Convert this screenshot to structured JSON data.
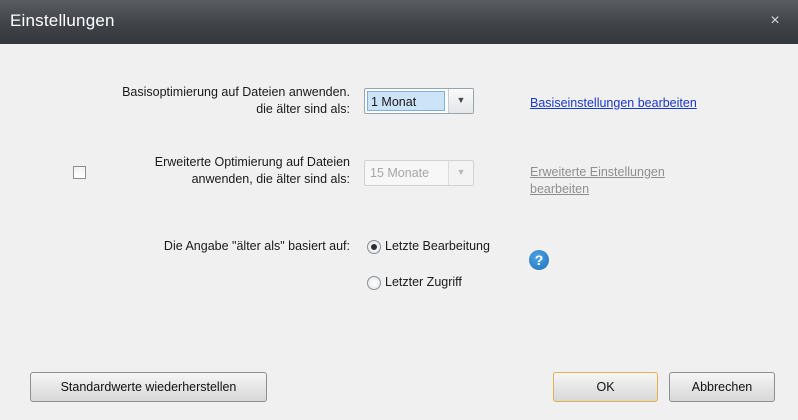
{
  "window": {
    "title": "Einstellungen",
    "close_glyph": "×"
  },
  "basic": {
    "label": "Basisoptimierung auf Dateien anwenden. die älter sind als:",
    "dropdown_value": "1 Monat",
    "link": "Basiseinstellungen bearbeiten"
  },
  "advanced": {
    "checked": false,
    "label": "Erweiterte Optimierung auf Dateien anwenden, die älter sind als:",
    "dropdown_value": "15 Monate",
    "link": "Erweiterte Einstellungen bearbeiten"
  },
  "basis": {
    "label": "Die Angabe \"älter als\" basiert auf:",
    "options": [
      {
        "label": "Letzte Bearbeitung",
        "selected": true
      },
      {
        "label": "Letzter Zugriff",
        "selected": false
      }
    ],
    "help_icon": "?"
  },
  "buttons": {
    "restore": "Standardwerte wiederherstellen",
    "ok": "OK",
    "cancel": "Abbrechen"
  }
}
